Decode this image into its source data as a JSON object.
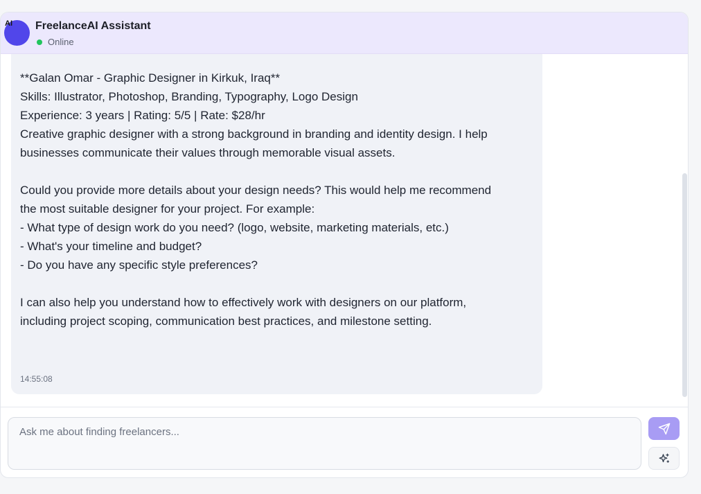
{
  "header": {
    "avatar_label": "AI",
    "title": "FreelanceAI Assistant",
    "status": "Online"
  },
  "message": {
    "text": "I'm happy to help you find a designer for your project. Here's a recommended designer\nfrom our marketplace:\n\n**Galan Omar - Graphic Designer in Kirkuk, Iraq**\nSkills: Illustrator, Photoshop, Branding, Typography, Logo Design\nExperience: 3 years | Rating: 5/5 | Rate: $28/hr\nCreative graphic designer with a strong background in branding and identity design. I help\nbusinesses communicate their values through memorable visual assets.\n\nCould you provide more details about your design needs? This would help me recommend\nthe most suitable designer for your project. For example:\n- What type of design work do you need? (logo, website, marketing materials, etc.)\n- What's your timeline and budget?\n- Do you have any specific style preferences?\n\nI can also help you understand how to effectively work with designers on our platform,\nincluding project scoping, communication best practices, and milestone setting.",
    "time": "14:55:08"
  },
  "composer": {
    "placeholder": "Ask me about finding freelancers...",
    "send_icon": "send-icon",
    "magic_icon": "sparkles-icon"
  },
  "colors": {
    "accent": "#5146ea",
    "header_bg": "#ece8fd",
    "online": "#22c55e",
    "send_button": "#a89cf4"
  }
}
